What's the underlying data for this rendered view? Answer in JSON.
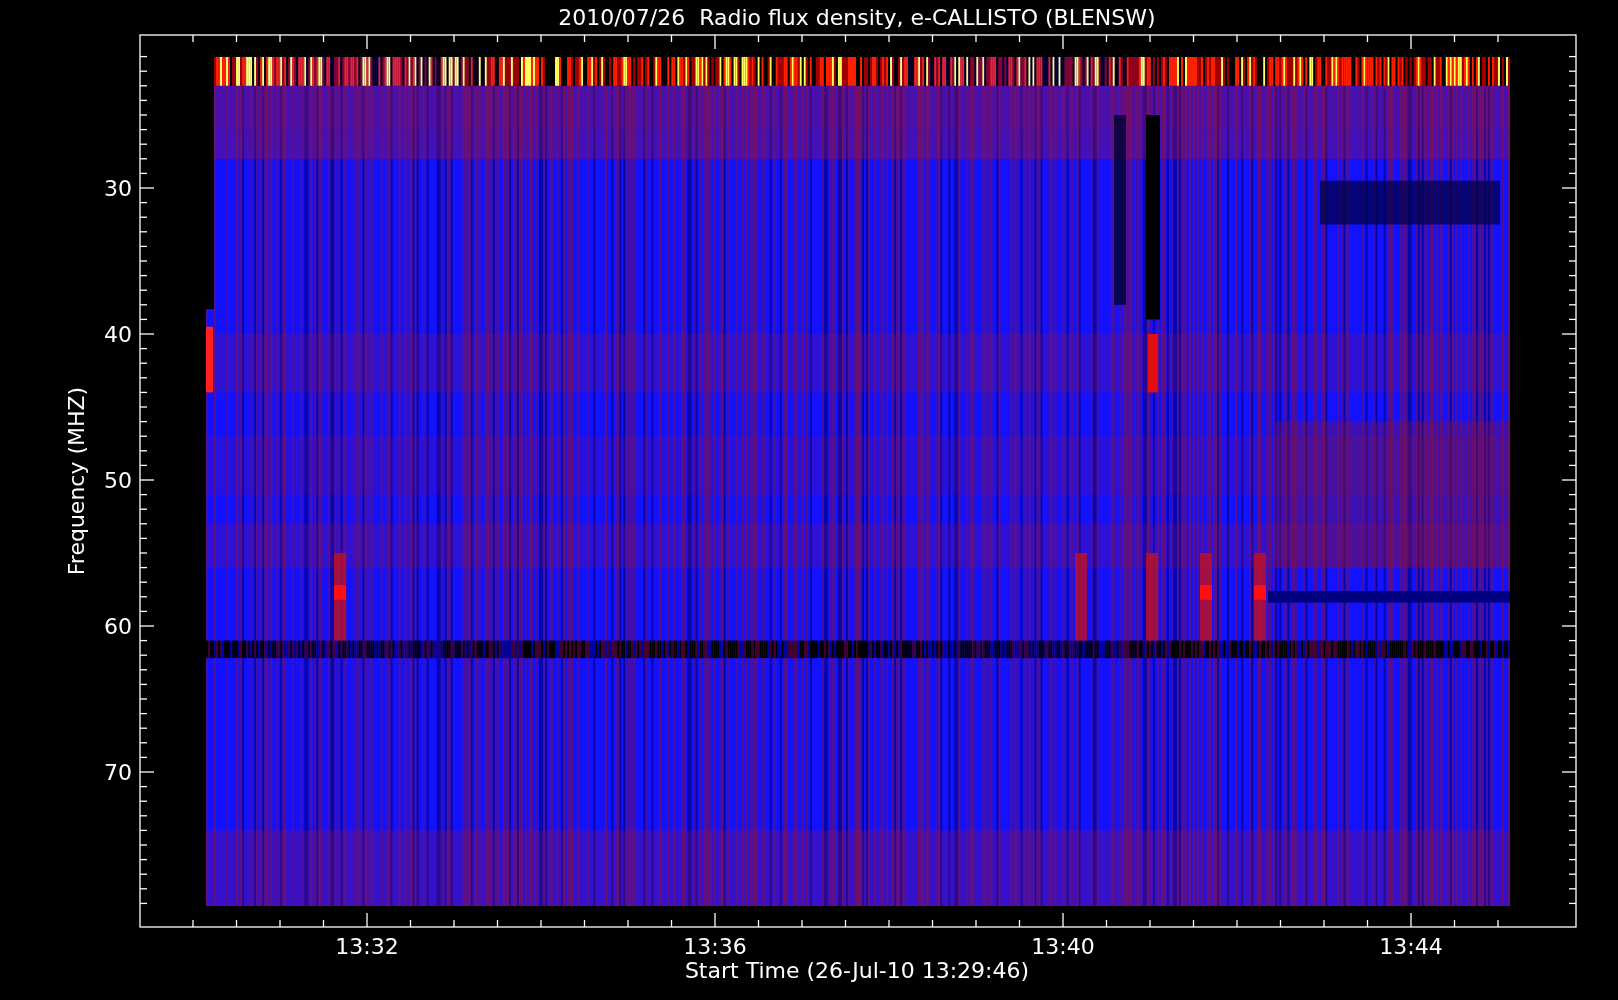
{
  "title": "2010/07/26  Radio flux density, e-CALLISTO (BLENSW)",
  "y_axis": {
    "label": "Frequency (MHZ)",
    "ticks": [
      "30",
      "40",
      "50",
      "60",
      "70"
    ]
  },
  "x_axis": {
    "label": "Start Time (26-Jul-10 13:29:46)",
    "ticks": [
      "13:32",
      "13:36",
      "13:40",
      "13:44"
    ]
  }
}
